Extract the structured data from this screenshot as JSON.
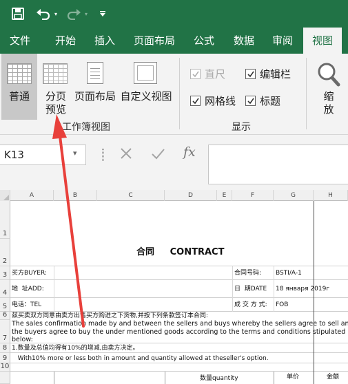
{
  "ribbon_tabs": [
    {
      "label": "文件"
    },
    {
      "label": "开始"
    },
    {
      "label": "插入"
    },
    {
      "label": "页面布局"
    },
    {
      "label": "公式"
    },
    {
      "label": "数据"
    },
    {
      "label": "审阅"
    },
    {
      "label": "视图",
      "active": true
    }
  ],
  "ribbon": {
    "normal_label": "普通",
    "page_break_label_1": "分页",
    "page_break_label_2": "预览",
    "page_layout_label": "页面布局",
    "custom_view_label": "自定义视图",
    "workbook_views_group": "工作簿视图",
    "ruler_label": "直尺",
    "formula_bar_label": "编辑栏",
    "gridlines_label": "网格线",
    "headings_label": "标题",
    "show_group": "显示",
    "zoom_label_1": "缩",
    "zoom_label_2": "放",
    "ruler_checked": true,
    "formula_bar_checked": true,
    "gridlines_checked": true,
    "headings_checked": true
  },
  "formula_bar": {
    "name_box": "K13",
    "fx": "fx"
  },
  "sheet": {
    "columns": [
      "A",
      "B",
      "C",
      "D",
      "E",
      "F",
      "G",
      "H"
    ],
    "rows": [
      "1",
      "2",
      "3",
      "4",
      "5",
      "6",
      "7",
      "8",
      "9",
      "10"
    ],
    "title": "合同     CONTRACT",
    "buyer_label": "买方BUYER:",
    "address_label": "地  址ADD:",
    "tel_label": "电话：TEL",
    "contract_no_label": "合同号码:",
    "contract_no": "BSTI/A-1",
    "date_label": "日  期DATE",
    "date_value": "18 января 2019г",
    "deal_label": "成 交 方 式:",
    "deal_value": "FOB",
    "row6_text": "兹买卖双方同意由卖方出售买方购进之下货物,并按下列条款签订本合同:",
    "row7_line1": "The sales confirmation made by and between the sellers and buys whereby the sellers agree to sell and",
    "row7_line2": "the  buyers agree to buy the under mentioned goods according to the terms and conditions stipulated",
    "row7_line3": "below:",
    "row8_text": "1.数量及总值均得有10%的增减,由卖方决定。",
    "row9_text": "   With10% more or less both in amount and quantity allowed at theseller's option.",
    "row11_qty": "数量quantity",
    "row11_unit": "单价",
    "row11_amount": "金额"
  }
}
